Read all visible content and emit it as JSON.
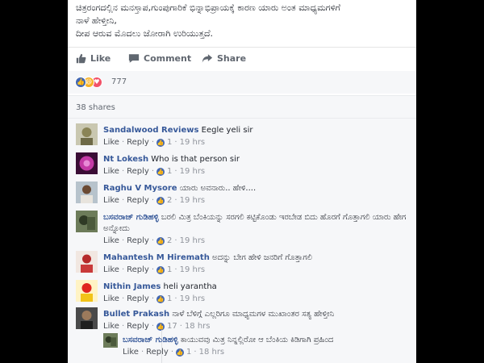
{
  "post": {
    "lines": [
      "ಚಿತ್ರರಂಗದಲ್ಲಿನ ಮನಸ್ತಾಪ,ಗುಂಪುಗಾರಿಕೆ ಭಿನ್ನಾಭಿಪ್ರಾಯಕ್ಕೆ ಕಾರಣ ಯಾರು ಅಂತ ಮಾಧ್ಯಮಗಳಿಗೆ",
      "ನಾಳೆ ಹೇಳ್ತೀನಿ,",
      "ದೀಪ ಆರುವ ಮೊದಲು ಜೋರಾಗಿ ಉರಿಯುತ್ತದೆ."
    ]
  },
  "actions": {
    "like": "Like",
    "comment": "Comment",
    "share": "Share"
  },
  "reactions": {
    "count": "777",
    "icons": [
      "like-icon",
      "haha-icon",
      "love-icon"
    ]
  },
  "shares": "38 shares",
  "colors": {
    "link": "#365899",
    "like_blue": "#4267b2",
    "love_red": "#f25268",
    "haha_yellow": "#f7b125"
  },
  "comments": [
    {
      "author": "Sandalwood Reviews",
      "text": "Eegle yeli sir",
      "likes": "1",
      "time": "19 hrs"
    },
    {
      "author": "Nt Lokesh",
      "text": "Who is that person sir",
      "likes": "1",
      "time": "19 hrs"
    },
    {
      "author": "Raghu V Mysore",
      "text": "ಯಾರು ಅವನಾರು.. ಹೇಳಿ....",
      "likes": "2",
      "time": "19 hrs"
    },
    {
      "author": "ಬಸವರಾಜ್ ಗುಡಿಹಳ್ಳಿ",
      "text": "ಬರಲಿ ಮಿತ್ರ ಬೆಂಕಿಯನ್ನು ಸರಗಲಿ ಕಟ್ಟಿಕೊಂಡು ಇರಬೇಡ ಬಿದು ಹೊರಗೆ ಗೊತ್ತಾಗಲಿ ಯಾರು ಹೇಗ ಅನ್ನೋದು",
      "likes": "2",
      "time": "19 hrs"
    },
    {
      "author": "Mahantesh M Hiremath",
      "text": "ಅದನ್ನು ಬೇಗ ಹೇಳಿ ಜನರಿಗೆ ಗೊತ್ತಾಗಲಿ",
      "likes": "1",
      "time": "19 hrs"
    },
    {
      "author": "Nithin James",
      "text": "heli yarantha",
      "likes": "1",
      "time": "19 hrs"
    },
    {
      "author": "Bullet Prakash",
      "text": "ನಾಳೆ ಬೆಳಿಗ್ಗೆ ಎಲ್ಲರಿಗೂ ಮಾಧ್ಯಮಗಳ ಮುಖಾಂತರ ಸತ್ಯ ಹೇಳ್ತೀನಿ",
      "likes": "17",
      "time": "18 hrs"
    }
  ],
  "reply": {
    "author": "ಬಸವರಾಜ್ ಗುಡಿಹಳ್ಳಿ",
    "text": "ಕಾಯುವವು ಮಿತ್ರ ನಿನ್ನಲ್ಲಿರೋ ಆ ಬೆಂಕಿಯ ಕಿಡಿಗಾಗಿ ಪ್ರಹಿಂದ",
    "likes": "1",
    "time": "18 hrs"
  },
  "comment_links": {
    "like": "Like",
    "reply": "Reply",
    "sep": "·"
  }
}
